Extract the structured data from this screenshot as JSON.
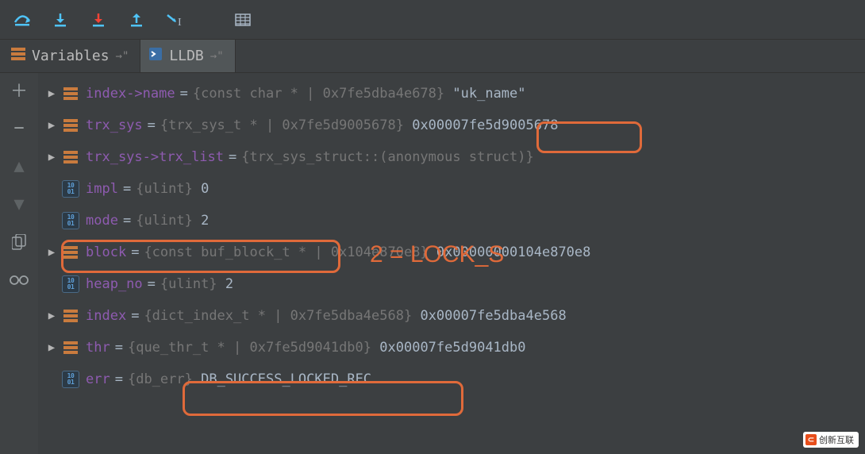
{
  "tabs": {
    "variables": "Variables",
    "lldb": "LLDB"
  },
  "rows": [
    {
      "exp": true,
      "kind": "struct",
      "name": "index",
      "accessor": "->name",
      "type": "{const char * | 0x7fe5dba4e678}",
      "val": "\"uk_name\""
    },
    {
      "exp": true,
      "kind": "struct",
      "name": "trx_sys",
      "accessor": "",
      "type": "{trx_sys_t * | 0x7fe5d9005678}",
      "val": "0x00007fe5d9005678"
    },
    {
      "exp": true,
      "kind": "struct",
      "name": "trx_sys",
      "accessor": "->trx_list",
      "type": "{trx_sys_struct::(anonymous struct)}",
      "val": ""
    },
    {
      "exp": false,
      "kind": "scalar",
      "name": "impl",
      "accessor": "",
      "type": "{ulint}",
      "val": "0"
    },
    {
      "exp": false,
      "kind": "scalar",
      "name": "mode",
      "accessor": "",
      "type": "{ulint}",
      "val": "2"
    },
    {
      "exp": true,
      "kind": "struct",
      "name": "block",
      "accessor": "",
      "type": "{const buf_block_t * | 0x104e870e8}",
      "val": "0x00000000104e870e8"
    },
    {
      "exp": false,
      "kind": "scalar",
      "name": "heap_no",
      "accessor": "",
      "type": "{ulint}",
      "val": "2"
    },
    {
      "exp": true,
      "kind": "struct",
      "name": "index",
      "accessor": "",
      "type": "{dict_index_t * | 0x7fe5dba4e568}",
      "val": "0x00007fe5dba4e568"
    },
    {
      "exp": true,
      "kind": "struct",
      "name": "thr",
      "accessor": "",
      "type": "{que_thr_t * | 0x7fe5d9041db0}",
      "val": "0x00007fe5d9041db0"
    },
    {
      "exp": false,
      "kind": "scalar",
      "name": "err",
      "accessor": "",
      "type": "{db_err}",
      "val": "DB_SUCCESS_LOCKED_REC"
    }
  ],
  "annotation": "2 = LOCK_S",
  "watermark": "创新互联"
}
